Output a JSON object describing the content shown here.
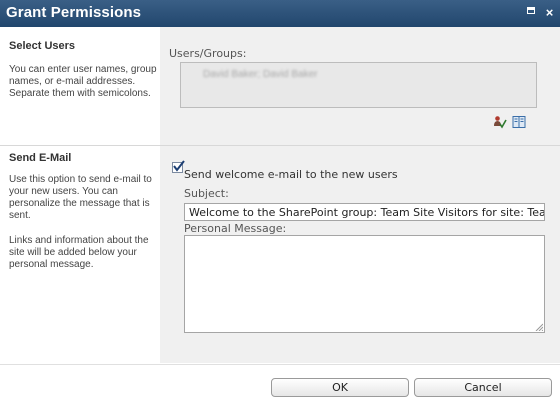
{
  "dialog": {
    "title": "Grant Permissions",
    "maximize_icon": "maximize-icon",
    "close_icon": "close-icon",
    "close_glyph": "×"
  },
  "select_users": {
    "heading": "Select Users",
    "description": "You can enter user names, group names, or e-mail addresses. Separate them with semicolons.",
    "field_label": "Users/Groups:",
    "value": "David Baker; David Baker",
    "check_names_icon": "check-names-icon",
    "browse_icon": "address-book-icon"
  },
  "send_email": {
    "heading": "Send E-Mail",
    "description_1": "Use this option to send e-mail to your new users. You can personalize the message that is sent.",
    "description_2": "Links and information about the site will be added below your personal message.",
    "checkbox_label": "Send welcome e-mail to the new users",
    "checkbox_checked": true,
    "subject_label": "Subject:",
    "subject_value": "Welcome to the SharePoint group: Team Site Visitors for site: Team Site",
    "message_label": "Personal Message:",
    "message_value": ""
  },
  "buttons": {
    "ok": "OK",
    "cancel": "Cancel"
  }
}
